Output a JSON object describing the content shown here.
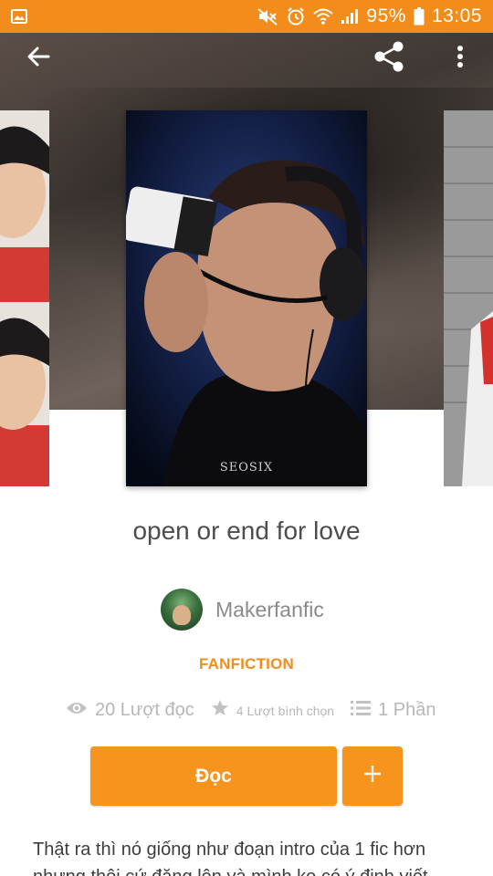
{
  "status_bar": {
    "battery_percent": "95%",
    "time": "13:05",
    "background_color": "#f28c1a",
    "icons": [
      "image-icon",
      "mute-icon",
      "alarm-icon",
      "wifi-icon",
      "signal-icon",
      "battery-icon"
    ]
  },
  "toolbar": {
    "icons": [
      "back-arrow-icon",
      "share-icon",
      "more-vert-icon"
    ]
  },
  "story": {
    "title": "open or end for love",
    "cover_watermark": "SEOSIX",
    "author": "Makerfanfic",
    "category": "FANFICTION",
    "category_color": "#f28c1a"
  },
  "stats": {
    "reads": "20 Lượt đọc",
    "votes": "4 Lượt bình chọn",
    "parts": "1 Phần"
  },
  "actions": {
    "read_label": "Đọc",
    "add_label": "+",
    "button_color": "#f7941d"
  },
  "description": {
    "line1": "Thật ra thì nó giống như đoạn intro của 1 fic hơn",
    "line2": "nhưng thôi cứ đăng lên và mình ko có ý định viết"
  }
}
